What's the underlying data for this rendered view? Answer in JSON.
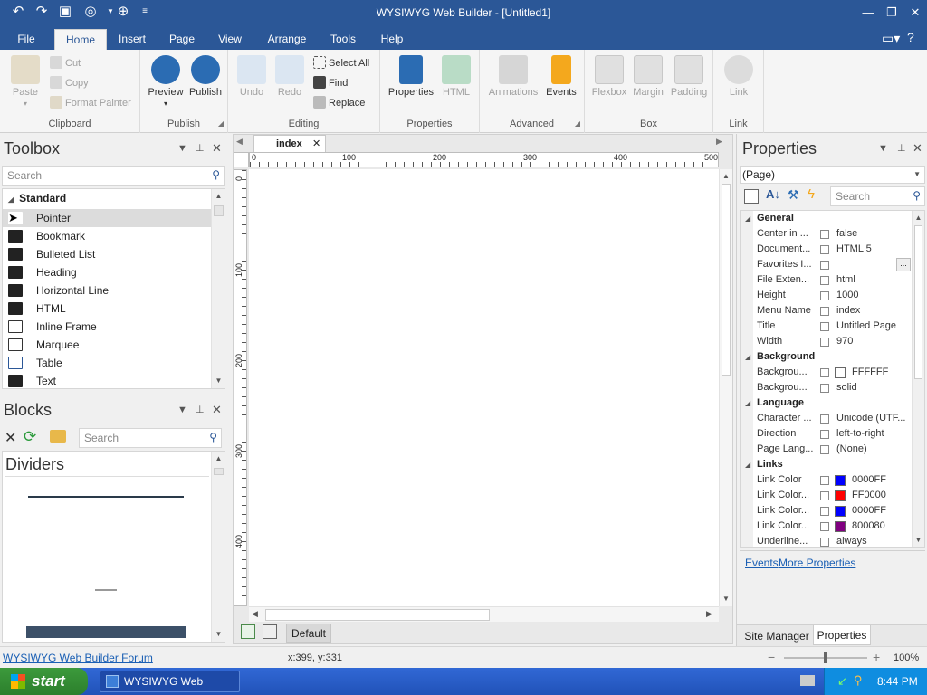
{
  "app": {
    "title": "WYSIWYG Web Builder - [Untitled1]"
  },
  "menu": {
    "tabs": [
      "File",
      "Home",
      "Insert",
      "Page",
      "View",
      "Arrange",
      "Tools",
      "Help"
    ],
    "active": "Home"
  },
  "ribbon": {
    "clipboard": {
      "label": "Clipboard",
      "paste": "Paste",
      "cut": "Cut",
      "copy": "Copy",
      "format_painter": "Format Painter"
    },
    "publish": {
      "label": "Publish",
      "preview": "Preview",
      "publish": "Publish"
    },
    "editing": {
      "label": "Editing",
      "undo": "Undo",
      "redo": "Redo",
      "select_all": "Select All",
      "find": "Find",
      "replace": "Replace"
    },
    "properties": {
      "label": "Properties",
      "properties": "Properties",
      "html": "HTML"
    },
    "advanced": {
      "label": "Advanced",
      "animations": "Animations",
      "events": "Events"
    },
    "box": {
      "label": "Box",
      "flexbox": "Flexbox",
      "margin": "Margin",
      "padding": "Padding"
    },
    "link": {
      "label": "Link",
      "link": "Link"
    }
  },
  "toolbox": {
    "title": "Toolbox",
    "search_placeholder": "Search",
    "category": "Standard",
    "items": [
      "Pointer",
      "Bookmark",
      "Bulleted List",
      "Heading",
      "Horizontal Line",
      "HTML",
      "Inline Frame",
      "Marquee",
      "Table",
      "Text"
    ]
  },
  "blocks": {
    "title": "Blocks",
    "search_placeholder": "Search",
    "section": "Dividers"
  },
  "document": {
    "tab": "index",
    "bottom_tab": "Default",
    "ruler_h": [
      "0",
      "100",
      "200",
      "300",
      "400",
      "500"
    ],
    "ruler_v": [
      "0",
      "100",
      "200",
      "300",
      "400"
    ]
  },
  "properties": {
    "title": "Properties",
    "selector": "(Page)",
    "search_placeholder": "Search",
    "sections": [
      {
        "name": "General",
        "rows": [
          {
            "name": "Center in ...",
            "value": "false"
          },
          {
            "name": "Document...",
            "value": "HTML 5"
          },
          {
            "name": "Favorites I...",
            "value": ""
          },
          {
            "name": "File Exten...",
            "value": "html"
          },
          {
            "name": "Height",
            "value": "1000"
          },
          {
            "name": "Menu Name",
            "value": "index"
          },
          {
            "name": "Title",
            "value": "Untitled Page"
          },
          {
            "name": "Width",
            "value": "970"
          }
        ]
      },
      {
        "name": "Background",
        "rows": [
          {
            "name": "Backgrou...",
            "value": "FFFFFF",
            "swatch": "#FFFFFF"
          },
          {
            "name": "Backgrou...",
            "value": "solid"
          }
        ]
      },
      {
        "name": "Language",
        "rows": [
          {
            "name": "Character ...",
            "value": "Unicode (UTF..."
          },
          {
            "name": "Direction",
            "value": "left-to-right"
          },
          {
            "name": "Page Lang...",
            "value": "(None)"
          }
        ]
      },
      {
        "name": "Links",
        "rows": [
          {
            "name": "Link Color",
            "value": "0000FF",
            "swatch": "#0000FF"
          },
          {
            "name": "Link Color...",
            "value": "FF0000",
            "swatch": "#FF0000"
          },
          {
            "name": "Link Color...",
            "value": "0000FF",
            "swatch": "#0000FF"
          },
          {
            "name": "Link Color...",
            "value": "800080",
            "swatch": "#800080"
          },
          {
            "name": "Underline...",
            "value": "always"
          }
        ]
      }
    ],
    "links": {
      "events": "Events",
      "more": "More Properties"
    },
    "bottom_tabs": [
      "Site Manager",
      "Properties"
    ]
  },
  "statusbar": {
    "forum_link": "WYSIWYG Web Builder Forum",
    "coords": "x:399, y:331",
    "zoom": "100%"
  },
  "taskbar": {
    "start": "start",
    "task": "WYSIWYG Web Build...",
    "time": "8:44 PM"
  }
}
